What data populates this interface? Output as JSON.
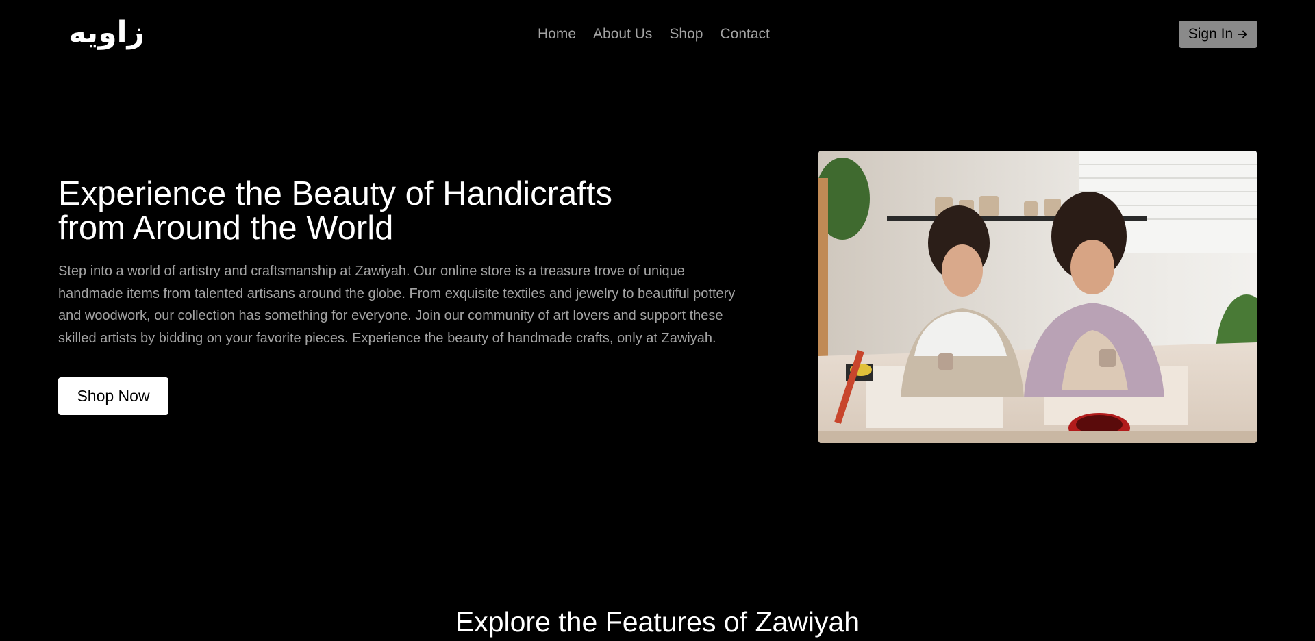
{
  "header": {
    "logo_text": "زاويه",
    "nav": [
      "Home",
      "About Us",
      "Shop",
      "Contact"
    ],
    "signin_label": "Sign In",
    "signin_icon": "arrow-right-icon"
  },
  "hero": {
    "title": "Experience the Beauty of Handicrafts from Around the World",
    "description": "Step into a world of artistry and craftsmanship at Zawiyah. Our online store is a treasure trove of unique handmade items from talented artisans around the globe. From exquisite textiles and jewelry to beautiful pottery and woodwork, our collection has something for everyone. Join our community of art lovers and support these skilled artists by bidding on your favorite pieces. Experience the beauty of handmade crafts, only at Zawiyah.",
    "cta_label": "Shop Now"
  },
  "features": {
    "title": "Explore the Features of Zawiyah"
  },
  "colors": {
    "background": "#000000",
    "text_primary": "#ffffff",
    "text_muted": "#a3a3a3",
    "signin_bg": "#8a8a8a",
    "cta_bg": "#ffffff"
  }
}
